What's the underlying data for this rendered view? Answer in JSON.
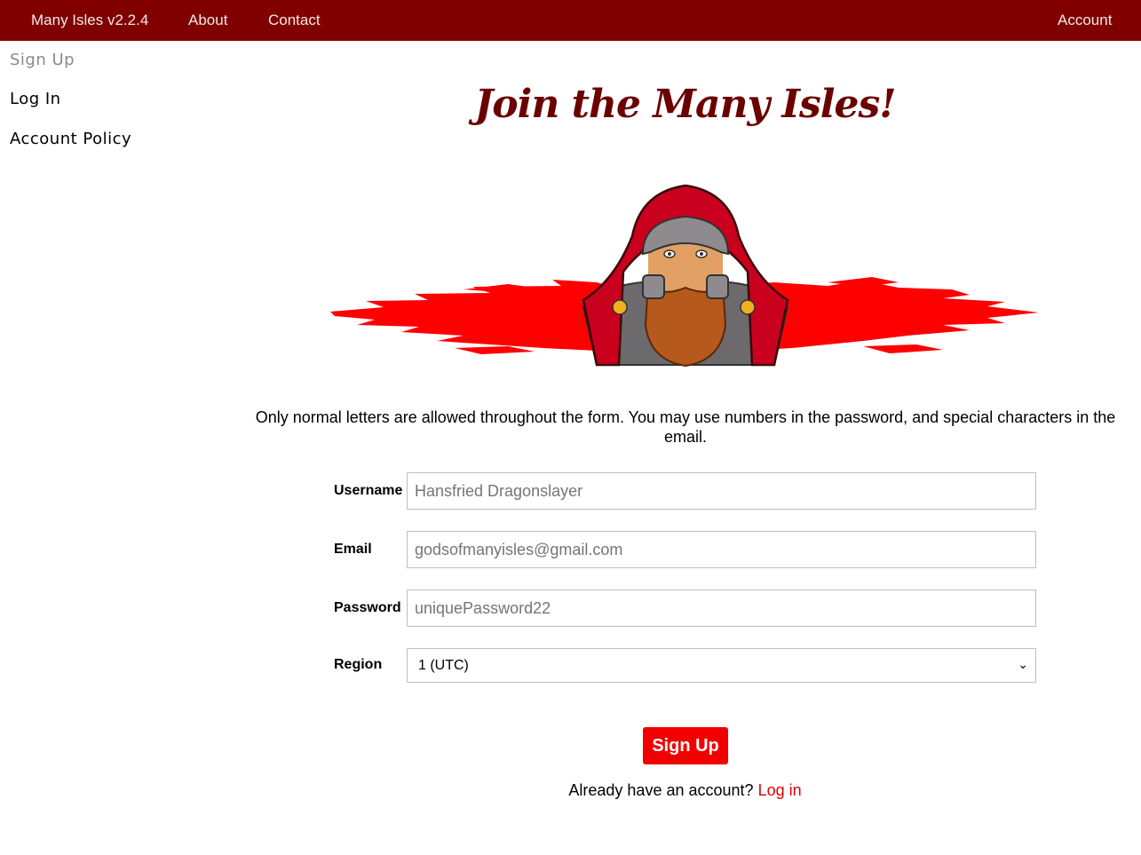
{
  "topnav": {
    "brand": "Many Isles v2.2.4",
    "about": "About",
    "contact": "Contact",
    "account": "Account"
  },
  "sidebar": {
    "items": [
      {
        "label": "Sign Up",
        "active": true
      },
      {
        "label": "Log In",
        "active": false
      },
      {
        "label": "Account Policy",
        "active": false
      }
    ]
  },
  "main": {
    "title": "Join the Many Isles!",
    "note": "Only normal letters are allowed throughout the form. You may use numbers in the password, and special characters in the email."
  },
  "form": {
    "username": {
      "label": "Username",
      "placeholder": "Hansfried Dragonslayer"
    },
    "email": {
      "label": "Email",
      "placeholder": "godsofmanyisles@gmail.com"
    },
    "password": {
      "label": "Password",
      "placeholder": "uniquePassword22"
    },
    "region": {
      "label": "Region",
      "selected": "1 (UTC)"
    },
    "submit_label": "Sign Up",
    "footer_prefix": "Already have an account?",
    "footer_link": "Log in"
  },
  "colors": {
    "nav_bg": "#800000",
    "accent": "#f20000",
    "title": "#6b0000"
  },
  "icons": {
    "hero": "hooded-dwarf-illustration",
    "select": "chevron-down-icon"
  }
}
